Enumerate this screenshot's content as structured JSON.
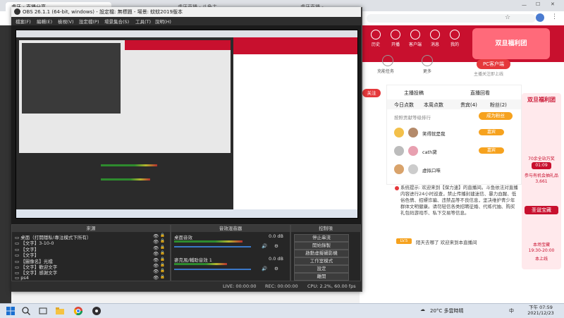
{
  "browser": {
    "tabs": [
      {
        "label": "虎牙 - 直播分享..."
      },
      {
        "label": "虎牙直播 - 斗鱼主播..."
      },
      {
        "label": "虎牙直播 - 全民..."
      }
    ],
    "nav": [
      "←",
      "→",
      "⟳"
    ]
  },
  "site": {
    "header_icons": [
      {
        "label": "历史",
        "icon": "history-icon"
      },
      {
        "label": "开播",
        "icon": "broadcast-icon"
      },
      {
        "label": "客户端",
        "icon": "client-icon"
      },
      {
        "label": "消息",
        "icon": "message-icon"
      },
      {
        "label": "我的",
        "icon": "user-icon"
      }
    ],
    "promo_title": "双旦福利团",
    "left_items": [
      {
        "label": "充能任务"
      },
      {
        "label": "更多"
      }
    ],
    "pc_client_label": "PC客户端",
    "pc_client_sub": "主播关注即上线",
    "follow_label": "关注",
    "ranking_tabs": [
      "主播投稿",
      "直播回看"
    ],
    "list_tabs": [
      {
        "label": "今日点数"
      },
      {
        "label": "本周点数"
      },
      {
        "label": "贵宾(4)"
      },
      {
        "label": "粉丝(2)"
      }
    ],
    "rank_header": "按照贡献等级排行",
    "rank_button": "成为粉丝",
    "rank_list": [
      {
        "name": "笑得就是我",
        "badge": "嘉宾"
      },
      {
        "name": "cath黛",
        "badge": "嘉宾"
      },
      {
        "name": "虚拟口味",
        "badge": ""
      }
    ],
    "system_notice": "系统提示:  欢迎来到【保力速】的直播间。斗鱼依法对直播内容进行24小时巡查，禁止传播封建迷信、暴力血腥、低俗色情、招嫖诈骗、违禁品等不良信息，坚决维护青少年群体文明健康。请勿轻信各类招聘征婚、代练代抽、购买礼包码游戏币、私下交易等信息。",
    "welcome_line": "陌天去哪了  欢迎来到本直播间",
    "welcome_badge": "LV.5",
    "side_promo": {
      "title": "双旦福利团",
      "line1": "70余全站万奖",
      "timer": "01:09",
      "line2": "参与有机会抽礼品",
      "count": "3,661",
      "title2": "圣诞宝藏",
      "line3": "本场宝藏",
      "time2": "19:30-20:00",
      "line4": "本上线"
    }
  },
  "obs": {
    "title": "OBS 26.1.1 (64-bit, windows) - 設定檔: 無標題 - 場景: 蚊蚊2019版本",
    "menu": [
      "檔案(F)",
      "編輯(E)",
      "檢視(V)",
      "設定檔(P)",
      "場景集合(S)",
      "工具(T)",
      "說明(H)"
    ],
    "docks": {
      "scenes_title": "來源",
      "mixer_title": "音效混音器",
      "controls_title": "控制項"
    },
    "sources": [
      {
        "label": "桌面（打開隱私!專注模式下所有）"
      },
      {
        "label": "【文字】3-10-0"
      },
      {
        "label": "【文字】"
      },
      {
        "label": "【文字】"
      },
      {
        "label": "【圖像名】光檔"
      },
      {
        "label": "【文字】歡迎文字"
      },
      {
        "label": "【文字】感謝文字"
      },
      {
        "label": "ps4"
      }
    ],
    "mixer": [
      {
        "label": "桌面音效",
        "db": "0.0 dB",
        "level": 0.62,
        "volume": 0.92
      },
      {
        "label": "麥克風/輔助音效 1",
        "db": "0.0 dB",
        "level": 0.48,
        "volume": 0.92
      }
    ],
    "controls": [
      "停止串流",
      "開始錄製",
      "啟動虛擬攝影機",
      "工作室模式",
      "設定",
      "離開"
    ],
    "status": {
      "live": "LIVE: 00:00:00",
      "rec": "REC: 00:00:00",
      "cpu": "CPU: 2.2%, 60.00 fps"
    }
  },
  "taskbar": {
    "weather": "20°C 多雲時晴",
    "time": "下午 07:59",
    "date": "2021/12/23",
    "lang": "中"
  }
}
